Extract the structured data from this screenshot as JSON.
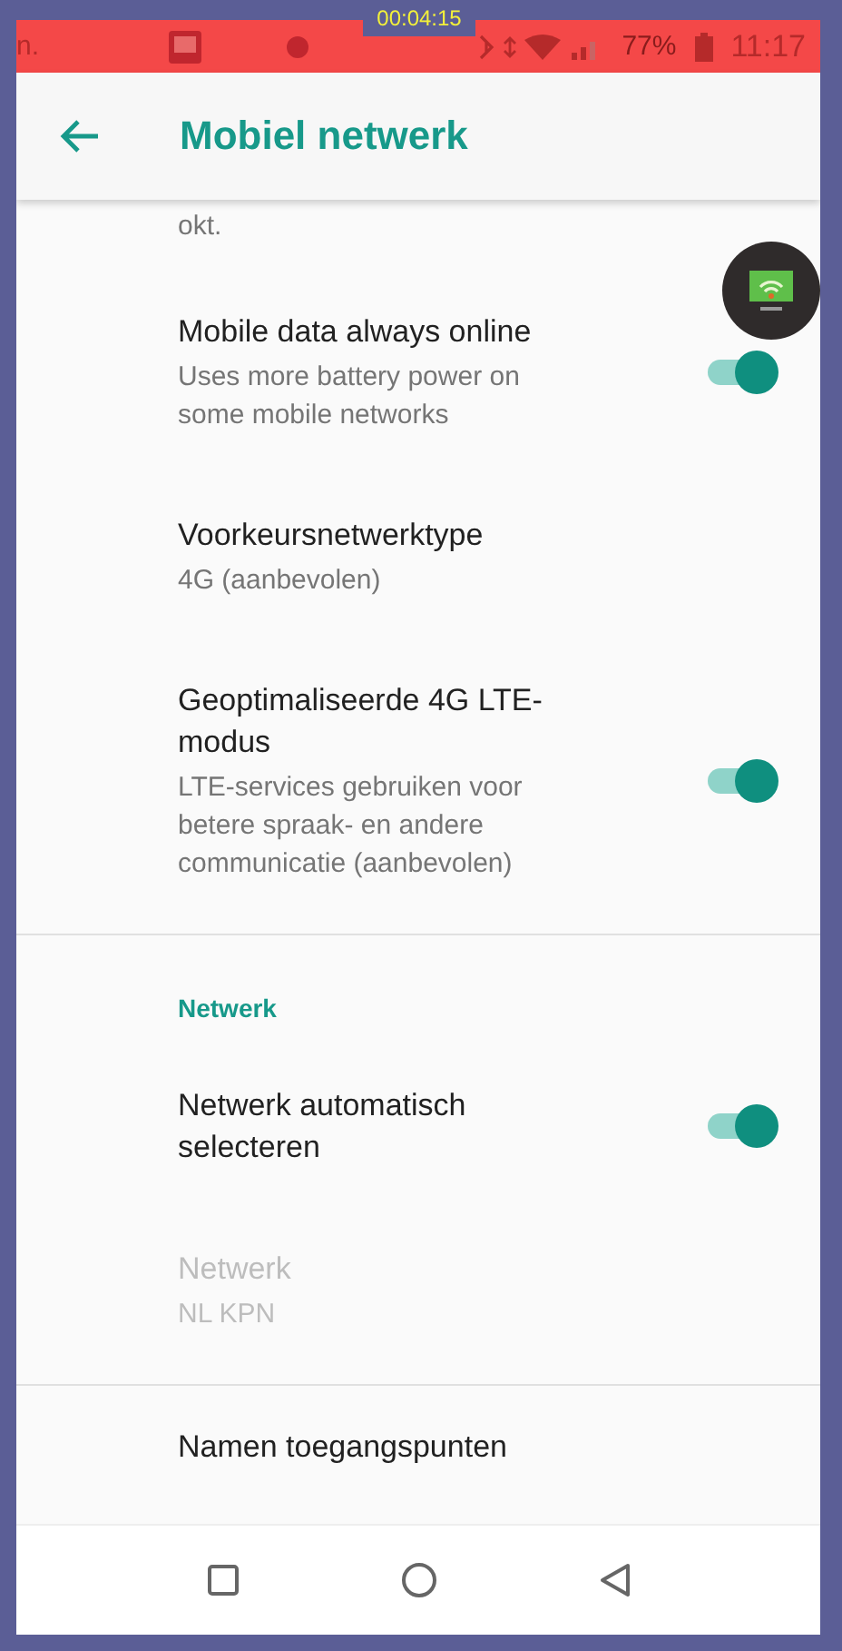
{
  "recording_timer": "00:04:15",
  "status_bar": {
    "left_text": "n.",
    "battery": "77%",
    "time": "11:17"
  },
  "app_bar": {
    "title": "Mobiel netwerk"
  },
  "items": [
    {
      "kind": "tail",
      "summary": "okt."
    },
    {
      "kind": "switch",
      "title": "Mobile data always online",
      "summary": "Uses more battery power on some mobile networks",
      "on": true,
      "disabled": false
    },
    {
      "kind": "text",
      "title": "Voorkeursnetwerktype",
      "summary": "4G (aanbevolen)",
      "disabled": false
    },
    {
      "kind": "switch",
      "title": "Geoptimaliseerde 4G LTE-modus",
      "summary": "LTE-services gebruiken voor betere spraak- en andere communicatie (aanbevolen)",
      "on": true,
      "disabled": false
    },
    {
      "kind": "divider"
    },
    {
      "kind": "header",
      "title": "Netwerk"
    },
    {
      "kind": "switch",
      "title": "Netwerk automatisch selecteren",
      "on": true,
      "disabled": false
    },
    {
      "kind": "text",
      "title": "Netwerk",
      "summary": "NL KPN",
      "disabled": true
    },
    {
      "kind": "divider"
    },
    {
      "kind": "text",
      "title": "Namen toegangspunten",
      "disabled": false
    }
  ]
}
